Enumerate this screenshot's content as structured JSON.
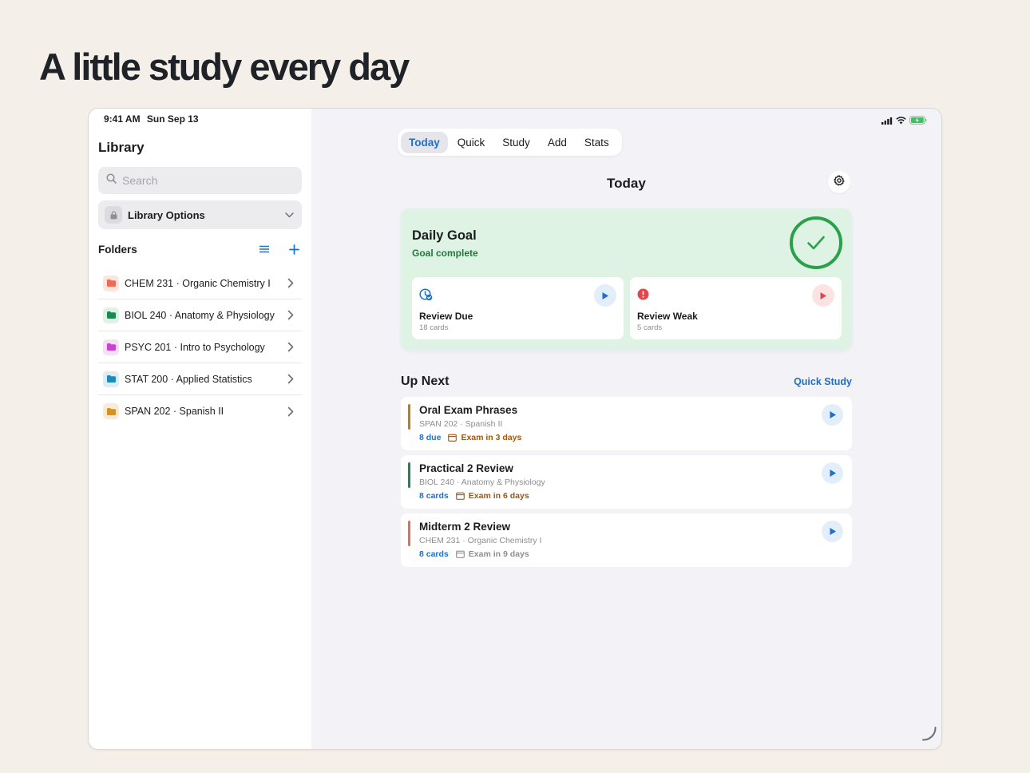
{
  "headline": "A little study every day",
  "status": {
    "time": "9:41 AM",
    "date": "Sun Sep 13"
  },
  "sidebar": {
    "title": "Library",
    "search_placeholder": "Search",
    "library_options": "Library Options",
    "folders_label": "Folders",
    "folders": [
      {
        "name": "CHEM 231 · Organic Chemistry I",
        "color": "#ef6a50",
        "bg": "#fde5df"
      },
      {
        "name": "BIOL 240 · Anatomy & Physiology",
        "color": "#1a8a52",
        "bg": "#dff2e6"
      },
      {
        "name": "PSYC 201 · Intro to Psychology",
        "color": "#cc3fd6",
        "bg": "#f6e0f8"
      },
      {
        "name": "STAT 200 · Applied Statistics",
        "color": "#1f8ab8",
        "bg": "#dcedf6"
      },
      {
        "name": "SPAN 202 · Spanish II",
        "color": "#d9901c",
        "bg": "#f9ebd6"
      }
    ]
  },
  "tabs": [
    {
      "label": "Today",
      "active": true
    },
    {
      "label": "Quick"
    },
    {
      "label": "Study"
    },
    {
      "label": "Add"
    },
    {
      "label": "Stats"
    }
  ],
  "page_title": "Today",
  "goal": {
    "title": "Daily Goal",
    "subtitle": "Goal complete",
    "review_due": {
      "title": "Review Due",
      "sub": "18 cards"
    },
    "review_weak": {
      "title": "Review Weak",
      "sub": "5 cards"
    }
  },
  "up_next": {
    "label": "Up Next",
    "link": "Quick Study",
    "items": [
      {
        "title": "Oral Exam Phrases",
        "sub": "SPAN 202 · Spanish II",
        "count": "8 due",
        "exam": "Exam in 3 days",
        "bar": "#c77a12",
        "exam_color": "#a4560e"
      },
      {
        "title": "Practical 2 Review",
        "sub": "BIOL 240 · Anatomy & Physiology",
        "count": "8 cards",
        "exam": "Exam in 6 days",
        "bar": "#1a8a52",
        "exam_color": "#a4560e"
      },
      {
        "title": "Midterm 2 Review",
        "sub": "CHEM 231 · Organic Chemistry I",
        "count": "8 cards",
        "exam": "Exam in 9 days",
        "bar": "#ef6a50",
        "exam_color": "#8e8e93"
      }
    ]
  },
  "colors": {
    "accent": "#1f6fc8",
    "success": "#2aa04a",
    "danger": "#e0474c"
  }
}
